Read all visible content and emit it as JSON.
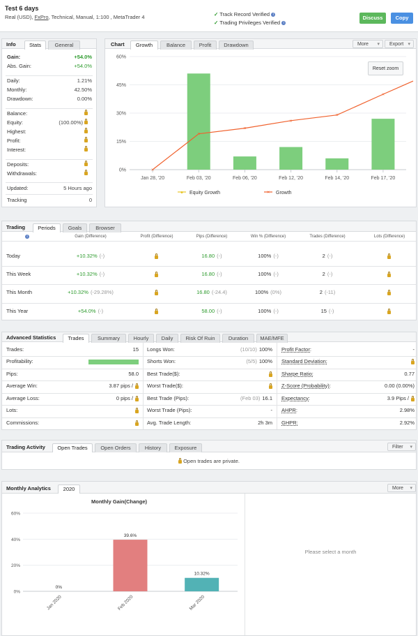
{
  "header": {
    "title": "Test 6 days",
    "subtitle_pre": "Real (USD), ",
    "broker": "FxPro",
    "subtitle_post": ", Technical, Manual, 1:100 , MetaTrader 4",
    "verified1": "Track Record Verified",
    "verified2": "Trading Privileges Verified",
    "discuss": "Discuss",
    "copy": "Copy"
  },
  "info": {
    "tabs": [
      "Info",
      "Stats",
      "General"
    ],
    "rows": [
      {
        "label": "Gain:",
        "value": "+54.0%"
      },
      {
        "label": "Abs. Gain:",
        "value": "+54.0%"
      },
      {
        "label": "Daily:",
        "value": "1.21%"
      },
      {
        "label": "Monthly:",
        "value": "42.50%"
      },
      {
        "label": "Drawdown:",
        "value": "0.00%"
      },
      {
        "label": "Balance:"
      },
      {
        "label": "Equity:",
        "value": "(100.00%)"
      },
      {
        "label": "Highest:"
      },
      {
        "label": "Profit:"
      },
      {
        "label": "Interest:"
      },
      {
        "label": "Deposits:"
      },
      {
        "label": "Withdrawals:"
      },
      {
        "label": "Updated:",
        "value": "5 Hours ago"
      },
      {
        "label": "Tracking",
        "value": "0"
      }
    ]
  },
  "chart_panel": {
    "label": "Chart",
    "tabs": [
      "Growth",
      "Balance",
      "Profit",
      "Drawdown"
    ],
    "more": "More",
    "export": "Export",
    "reset_zoom": "Reset zoom",
    "legend": [
      "Equity Growth",
      "Growth"
    ]
  },
  "chart_data": [
    {
      "type": "bar+line",
      "categories": [
        "Jan 28, '20",
        "Feb 03, '20",
        "Feb 06, '20",
        "Feb 12, '20",
        "Feb 14, '20",
        "Feb 17, '20"
      ],
      "bars": [
        0,
        51,
        7,
        12,
        6,
        27
      ],
      "line_x": [
        0,
        1,
        2,
        3,
        4,
        5,
        5.7
      ],
      "line_y": [
        0,
        19,
        22,
        26,
        29,
        40,
        47
      ],
      "yticks": [
        "0%",
        "15%",
        "30%",
        "45%",
        "60%"
      ],
      "ylim": [
        0,
        60
      ],
      "legend": "bottom"
    },
    {
      "type": "bar",
      "title": "Monthly Gain(Change)",
      "categories": [
        "Jan 2020",
        "Feb 2020",
        "Mar 2020"
      ],
      "values": [
        0,
        39.6,
        10.32
      ],
      "data_labels": [
        "0%",
        "39.6%",
        "10.32%"
      ],
      "yticks": [
        "0%",
        "20%",
        "40%",
        "60%"
      ],
      "ylim": [
        0,
        60
      ]
    }
  ],
  "trading": {
    "label": "Trading",
    "tabs": [
      "Periods",
      "Goals",
      "Browser"
    ],
    "columns": [
      "Gain (Difference)",
      "Profit (Difference)",
      "Pips (Difference)",
      "Win % (Difference)",
      "Trades (Difference)",
      "Lots (Difference)"
    ],
    "rows": [
      {
        "name": "Today",
        "gain": "+10.32%",
        "gain_d": "(-)",
        "pips": "16.80",
        "pips_d": "(-)",
        "win": "100%",
        "win_d": "(-)",
        "trades": "2",
        "trades_d": "(-)"
      },
      {
        "name": "This Week",
        "gain": "+10.32%",
        "gain_d": "(-)",
        "pips": "16.80",
        "pips_d": "(-)",
        "win": "100%",
        "win_d": "(-)",
        "trades": "2",
        "trades_d": "(-)"
      },
      {
        "name": "This Month",
        "gain": "+10.32%",
        "gain_d": "(-29.28%)",
        "pips": "16.80",
        "pips_d": "(-24.4)",
        "win": "100%",
        "win_d": "(0%)",
        "trades": "2",
        "trades_d": "(-11)"
      },
      {
        "name": "This Year",
        "gain": "+54.0%",
        "gain_d": "(-)",
        "pips": "58.00",
        "pips_d": "(-)",
        "win": "100%",
        "win_d": "(-)",
        "trades": "15",
        "trades_d": "(-)"
      }
    ]
  },
  "advanced": {
    "label": "Advanced Statistics",
    "tabs": [
      "Trades",
      "Summary",
      "Hourly",
      "Daily",
      "Risk Of Ruin",
      "Duration",
      "MAE/MFE"
    ],
    "col1": [
      {
        "label": "Trades:",
        "value": "15"
      },
      {
        "label": "Profitability:",
        "bar": 1.0
      },
      {
        "label": "Pips:",
        "value": "58.0"
      },
      {
        "label": "Average Win:",
        "value": "3.87 pips /"
      },
      {
        "label": "Average Loss:",
        "value": "0 pips /"
      },
      {
        "label": "Lots:"
      },
      {
        "label": "Commissions:"
      }
    ],
    "col2": [
      {
        "label": "Longs Won:",
        "sub": "(10/10)",
        "value": "100%"
      },
      {
        "label": "Shorts Won:",
        "sub": "(5/5)",
        "value": "100%"
      },
      {
        "label": "Best Trade($):"
      },
      {
        "label": "Worst Trade($):"
      },
      {
        "label": "Best Trade (Pips):",
        "sub": "(Feb 03)",
        "value": "16.1"
      },
      {
        "label": "Worst Trade (Pips):",
        "value": "-"
      },
      {
        "label": "Avg. Trade Length:",
        "value": "2h 3m"
      }
    ],
    "col3": [
      {
        "label": "Profit Factor:",
        "value": "-"
      },
      {
        "label": "Standard Deviation:"
      },
      {
        "label": "Sharpe Ratio:",
        "value": "0.77"
      },
      {
        "label": "Z-Score (Probability):",
        "value": "0.00 (0.00%)"
      },
      {
        "label": "Expectancy:",
        "value": "3.9 Pips /"
      },
      {
        "label": "AHPR:",
        "value": "2.98%"
      },
      {
        "label": "GHPR:",
        "value": "2.92%"
      }
    ]
  },
  "activity": {
    "label": "Trading Activity",
    "tabs": [
      "Open Trades",
      "Open Orders",
      "History",
      "Exposure"
    ],
    "filter": "Filter",
    "message": "Open trades are private."
  },
  "monthly": {
    "label": "Monthly Analytics",
    "tab": "2020",
    "more": "More",
    "select_msg": "Please select a month"
  },
  "colors": {
    "green_bar": "#7dce7d",
    "line": "#f0622e",
    "equity": "#e8c62a",
    "feb_bar": "#e27f7f",
    "mar_bar": "#52b2b5",
    "discuss": "#5cb85c",
    "copy": "#4a90e2"
  }
}
